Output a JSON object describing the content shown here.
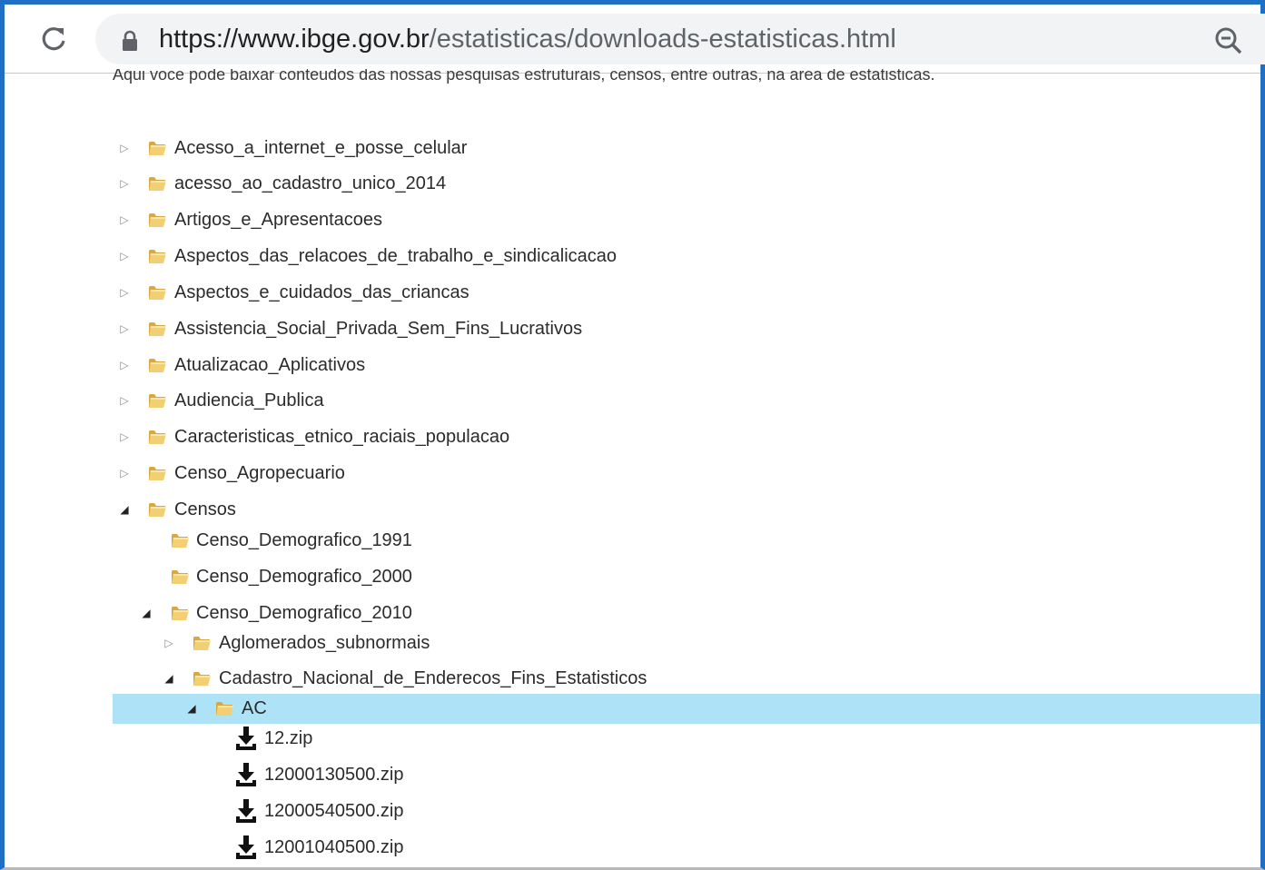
{
  "browser": {
    "url_host": "https://www.ibge.gov.br",
    "url_path": "/estatisticas/downloads-estatisticas.html"
  },
  "page": {
    "intro": "Aqui voce pode baixar conteudos das nossas pesquisas estruturais, censos, entre outras, na area de estatisticas."
  },
  "tree": {
    "top_level": [
      "Acesso_a_internet_e_posse_celular",
      "acesso_ao_cadastro_unico_2014",
      "Artigos_e_Apresentacoes",
      "Aspectos_das_relacoes_de_trabalho_e_sindicalicacao",
      "Aspectos_e_cuidados_das_criancas",
      "Assistencia_Social_Privada_Sem_Fins_Lucrativos",
      "Atualizacao_Aplicativos",
      "Audiencia_Publica",
      "Caracteristicas_etnico_raciais_populacao",
      "Censo_Agropecuario",
      "Censos"
    ],
    "censos_children": [
      "Censo_Demografico_1991",
      "Censo_Demografico_2000",
      "Censo_Demografico_2010"
    ],
    "censo2010_children": [
      "Aglomerados_subnormais",
      "Cadastro_Nacional_de_Enderecos_Fins_Estatisticos"
    ],
    "cnefe_children": [
      "AC"
    ],
    "ac_files": [
      "12.zip",
      "12000130500.zip",
      "12000540500.zip",
      "12001040500.zip"
    ]
  },
  "colors": {
    "border": "#1f6fc5",
    "selected": "#aee3f7",
    "folder": "#e9c25f"
  },
  "icons": {
    "reload": "reload-icon",
    "lock": "lock-icon",
    "zoom": "zoom-out-icon",
    "folder": "folder-icon",
    "download": "download-icon",
    "collapsed": "triangle-right-icon",
    "expanded": "triangle-down-icon"
  }
}
